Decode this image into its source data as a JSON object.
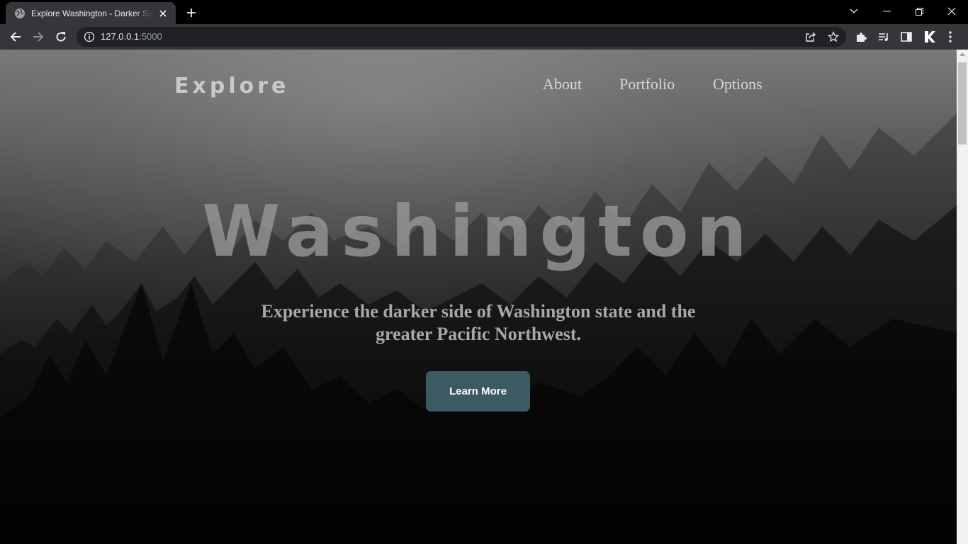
{
  "browser": {
    "tab_title": "Explore Washington - Darker Side of Washington",
    "url_host": "127.0.0.1",
    "url_port": ":5000"
  },
  "site": {
    "brand": "Explore",
    "nav": [
      {
        "label": "About"
      },
      {
        "label": "Portfolio"
      },
      {
        "label": "Options"
      }
    ],
    "hero_title": "Washington",
    "hero_subtitle_line1": "Experience the darker side of Washington state and the",
    "hero_subtitle_line2": "greater Pacific Northwest.",
    "cta_label": "Learn More"
  },
  "colors": {
    "cta_bg": "#3b5a62",
    "chrome_tab": "#35363a",
    "chrome_omnibox": "#202124"
  },
  "icons": [
    "globe-icon",
    "close-icon",
    "plus-icon",
    "chevron-down-icon",
    "minimize-icon",
    "restore-icon",
    "window-close-icon",
    "back-arrow-icon",
    "forward-arrow-icon",
    "reload-icon",
    "info-icon",
    "share-icon",
    "star-icon",
    "puzzle-icon",
    "media-control-icon",
    "side-panel-icon",
    "k-extension-icon",
    "kebab-menu-icon"
  ]
}
